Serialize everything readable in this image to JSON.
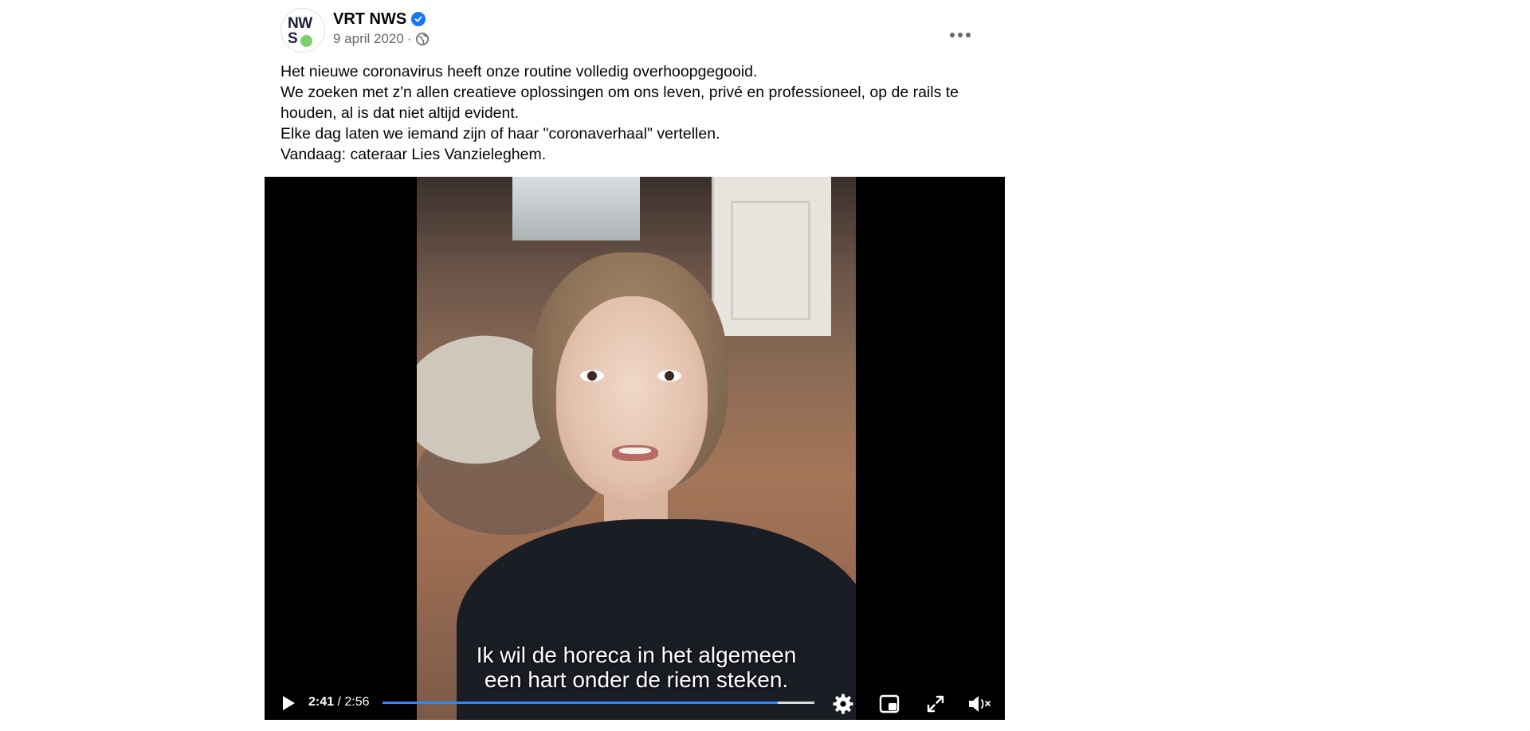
{
  "post": {
    "page_name": "VRT NWS",
    "avatar": {
      "line1": "NW",
      "line2": "S"
    },
    "date": "9 april 2020",
    "separator": "·",
    "text_lines": [
      "Het nieuwe coronavirus heeft onze routine volledig overhoopgegooid.",
      "We zoeken met z'n allen creatieve oplossingen om ons leven, privé en professioneel, op de rails te houden, al is dat niet altijd evident.",
      "Elke dag laten we iemand zijn of haar \"coronaverhaal\" vertellen.",
      "Vandaag: cateraar Lies Vanzieleghem."
    ]
  },
  "video": {
    "subtitle_line1": "Ik wil de horeca in het algemeen",
    "subtitle_line2": "een hart onder de riem steken.",
    "current_time": "2:41",
    "time_separator": " / ",
    "duration": "2:56",
    "progress_fraction": 0.915,
    "buffered_fraction": 1.0,
    "icons": [
      "play-icon",
      "gear-icon",
      "picture-in-picture-icon",
      "fullscreen-icon",
      "volume-muted-icon"
    ]
  },
  "colors": {
    "accent": "#2d88ff",
    "verified": "#1877f2",
    "meta_text": "#65676b",
    "video_bg": "#000000"
  }
}
